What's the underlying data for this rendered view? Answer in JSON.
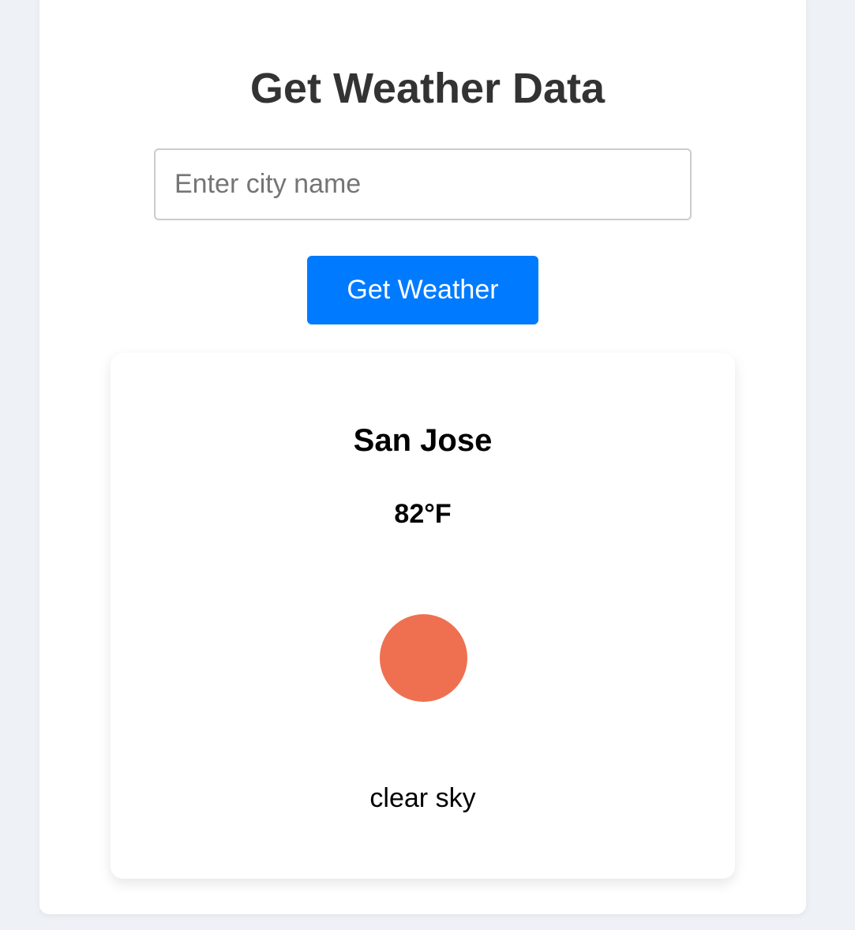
{
  "header": {
    "title": "Get Weather Data"
  },
  "search": {
    "value": "",
    "placeholder": "Enter city name"
  },
  "actions": {
    "get_weather_label": "Get Weather"
  },
  "weather": {
    "city": "San Jose",
    "temperature": "82°F",
    "description": "clear sky",
    "icon": "sun-icon",
    "icon_color": "#ee7050"
  },
  "colors": {
    "accent": "#007bff",
    "background": "#eef2f7",
    "title": "#333333"
  }
}
